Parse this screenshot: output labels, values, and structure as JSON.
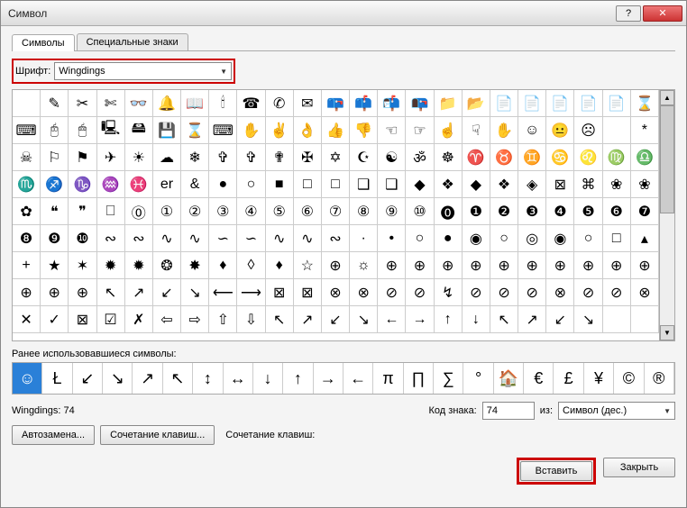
{
  "title": "Символ",
  "tabs": {
    "symbols": "Символы",
    "special": "Специальные знаки"
  },
  "font": {
    "label": "Шрифт:",
    "value": "Wingdings"
  },
  "grid_symbols": [
    [
      "",
      "✎",
      "✂",
      "✄",
      "👓",
      "🔔",
      "📖",
      "🕯",
      "☎",
      "✆",
      "✉",
      "📪",
      "📫",
      "📬",
      "📭",
      "📁",
      "📂",
      "📄",
      "📄",
      "📄",
      "📄",
      "📄",
      "⌛"
    ],
    [
      "⌨",
      "🖰",
      "🖱",
      "🖳",
      "🖴",
      "💾",
      "⌛",
      "⌨",
      "✋",
      "✌",
      "👌",
      "👍",
      "👎",
      "☜",
      "☞",
      "☝",
      "☟",
      "✋",
      "☺",
      "😐",
      "☹",
      " ",
      "*"
    ],
    [
      "☠",
      "⚐",
      "⚑",
      "✈",
      "☀",
      "☁",
      "❄",
      "✞",
      "✞",
      "✟",
      "✠",
      "✡",
      "☪",
      "☯",
      "ॐ",
      "☸",
      "♈",
      "♉",
      "♊",
      "♋",
      "♌",
      "♍",
      "♎"
    ],
    [
      "♏",
      "♐",
      "♑",
      "♒",
      "♓",
      "er",
      "&",
      "●",
      "○",
      "■",
      "□",
      "□",
      "❑",
      "❑",
      "◆",
      "❖",
      "◆",
      "❖",
      "◈",
      "⊠",
      "⌘",
      "❀",
      "❀"
    ],
    [
      "✿",
      "❝",
      "❞",
      "⎕",
      "⓪",
      "①",
      "②",
      "③",
      "④",
      "⑤",
      "⑥",
      "⑦",
      "⑧",
      "⑨",
      "⑩",
      "⓿",
      "❶",
      "❷",
      "❸",
      "❹",
      "❺",
      "❻",
      "❼"
    ],
    [
      "❽",
      "❾",
      "❿",
      "∾",
      "∾",
      "∿",
      "∿",
      "∽",
      "∽",
      "∿",
      "∿",
      "∾",
      "·",
      "•",
      "○",
      "●",
      "◉",
      "○",
      "◎",
      "◉",
      "○",
      "□",
      "▴"
    ],
    [
      "+",
      "★",
      "✶",
      "✹",
      "✹",
      "❂",
      "✸",
      "♦",
      "◊",
      "♦",
      "☆",
      "⊕",
      "☼",
      "⊕",
      "⊕",
      "⊕",
      "⊕",
      "⊕",
      "⊕",
      "⊕",
      "⊕",
      "⊕",
      "⊕"
    ],
    [
      "⊕",
      "⊕",
      "⊕",
      "↖",
      "↗",
      "↙",
      "↘",
      "⟵",
      "⟶",
      "⊠",
      "⊠",
      "⊗",
      "⊗",
      "⊘",
      "⊘",
      "↯",
      "⊘",
      "⊘",
      "⊘",
      "⊗",
      "⊘",
      "⊘",
      "⊗"
    ],
    [
      "✕",
      "✓",
      "⊠",
      "☑",
      "✗",
      "⇦",
      "⇨",
      "⇧",
      "⇩",
      "↖",
      "↗",
      "↙",
      "↘",
      "←",
      "→",
      "↑",
      "↓",
      "↖",
      "↗",
      "↙",
      "↘",
      " ",
      " "
    ]
  ],
  "recent": {
    "label": "Ранее использовавшиеся символы:",
    "items": [
      "☺",
      "Ł",
      "↙",
      "↘",
      "↗",
      "↖",
      "↕",
      "↔",
      "↓",
      "↑",
      "→",
      "←",
      "π",
      "∏",
      "∑",
      "°",
      "🏠",
      "€",
      "£",
      "¥",
      "©",
      "®"
    ]
  },
  "info": {
    "name": "Wingdings: 74",
    "code_label": "Код знака:",
    "code_value": "74",
    "from_label": "из:",
    "from_value": "Символ (дес.)"
  },
  "buttons": {
    "autocorrect": "Автозамена...",
    "shortcut": "Сочетание клавиш...",
    "shortcut_label": "Сочетание клавиш:",
    "insert": "Вставить",
    "close": "Закрыть"
  },
  "titlebar": {
    "help": "?",
    "close": "✕"
  }
}
